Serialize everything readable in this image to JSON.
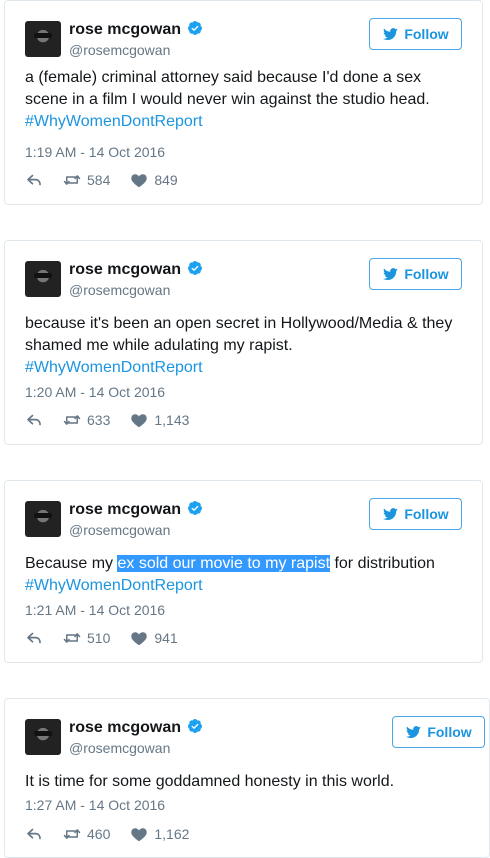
{
  "colors": {
    "link_blue": "#1b95e0",
    "secondary_text": "#657786",
    "highlight": "#3399ff"
  },
  "tweets": [
    {
      "display_name": "rose mcgowan",
      "handle": "@rosemcgowan",
      "follow_label": "Follow",
      "text": "a (female) criminal attorney said because I'd done a sex scene in a film I would never win against the studio head.",
      "hashtag": "#WhyWomenDontReport",
      "timestamp": "1:19 AM - 14 Oct 2016",
      "retweets": "584",
      "likes": "849"
    },
    {
      "display_name": "rose mcgowan",
      "handle": "@rosemcgowan",
      "follow_label": "Follow",
      "text": "because it's been an open secret in Hollywood/Media & they shamed me while adulating my rapist.",
      "hashtag": "#WhyWomenDontReport",
      "timestamp": "1:20 AM - 14 Oct 2016",
      "retweets": "633",
      "likes": "1,143"
    },
    {
      "display_name": "rose mcgowan",
      "handle": "@rosemcgowan",
      "follow_label": "Follow",
      "text_before": "Because my ",
      "text_highlight": "ex sold our movie to my rapist",
      "text_after": " for distribution",
      "hashtag": "#WhyWomenDontReport",
      "timestamp": "1:21 AM - 14 Oct 2016",
      "retweets": "510",
      "likes": "941"
    },
    {
      "display_name": "rose mcgowan",
      "handle": "@rosemcgowan",
      "follow_label": "Follow",
      "text": "It is time for some goddamned honesty in this world.",
      "timestamp": "1:27 AM - 14 Oct 2016",
      "retweets": "460",
      "likes": "1,162"
    }
  ]
}
